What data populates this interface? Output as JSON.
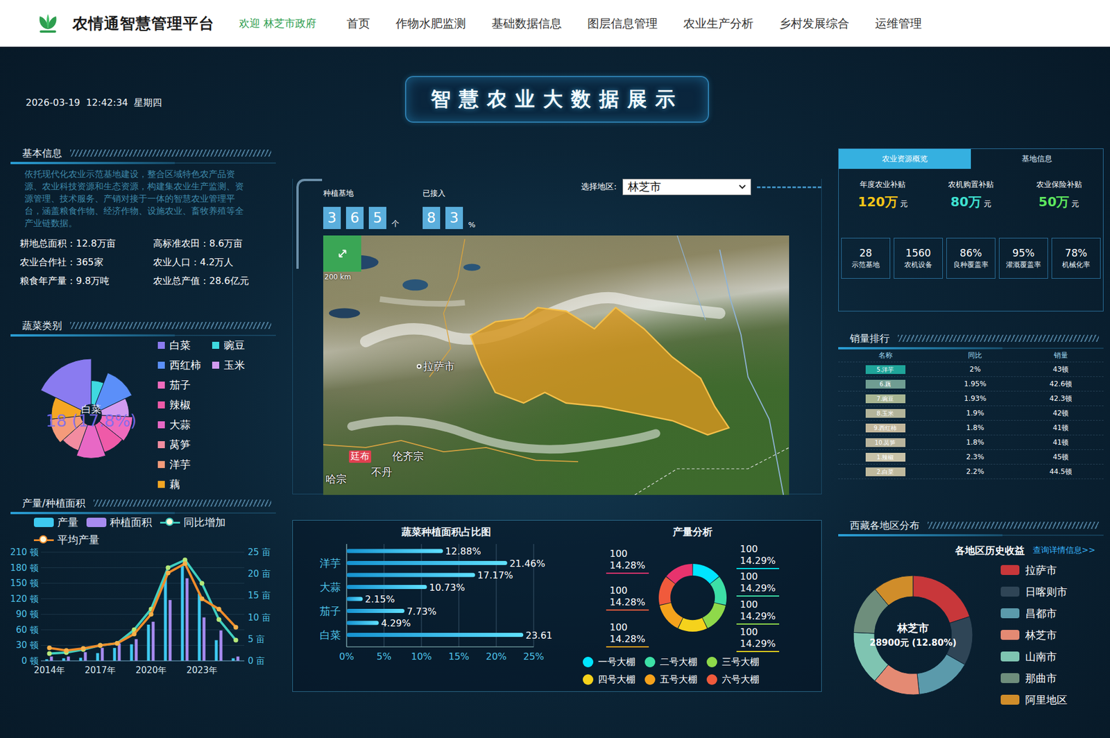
{
  "header": {
    "title": "农情通智慧管理平台",
    "welcome": "欢迎 林芝市政府",
    "nav": [
      {
        "label": "首页",
        "selected": false
      },
      {
        "label": "作物水肥监测",
        "selected": false
      },
      {
        "label": "基础数据信息",
        "selected": false
      },
      {
        "label": "图层信息管理",
        "selected": false
      },
      {
        "label": "农业生产分析",
        "selected": false
      },
      {
        "label": "乡村发展综合",
        "selected": false
      },
      {
        "label": "运维管理",
        "selected": false
      }
    ]
  },
  "datetime": "2026-03-19  12:42:34  星期四",
  "banner_title": "智慧农业大数据展示",
  "basic_info": {
    "title": "基本信息",
    "intro": "依托现代化农业示范基地建设，整合区域特色农产品资源、农业科技资源和生态资源，构建集农业生产监测、资源管理、技术服务、产销对接于一体的智慧农业管理平台，涵盖粮食作物、经济作物、设施农业、畜牧养殖等全产业链数据。",
    "stats": [
      {
        "label": "耕地总面积：",
        "value": "12.8万亩"
      },
      {
        "label": "高标准农田：",
        "value": "8.6万亩"
      },
      {
        "label": "农业合作社：",
        "value": "365家"
      },
      {
        "label": "农业人口：",
        "value": "4.2万人"
      },
      {
        "label": "粮食年产量：",
        "value": "9.8万吨"
      },
      {
        "label": "农业总产值：",
        "value": "28.6亿元"
      }
    ]
  },
  "veg_categories": {
    "title": "蔬菜类别",
    "center_name": "白菜",
    "center_value": "18 (17.8%)",
    "items": [
      {
        "name": "白菜",
        "value": 18,
        "color": "#8a7bf0"
      },
      {
        "name": "豌豆",
        "value": 6,
        "color": "#3fd9e0"
      },
      {
        "name": "西红柿",
        "value": 12,
        "color": "#5b8ff9"
      },
      {
        "name": "玉米",
        "value": 8,
        "color": "#d29bf0"
      },
      {
        "name": "茄子",
        "value": 10,
        "color": "#f06bbd"
      },
      {
        "name": "辣椒",
        "value": 9,
        "color": "#ef5aa8"
      },
      {
        "name": "大蒜",
        "value": 11,
        "color": "#e868c5"
      },
      {
        "name": "莴笋",
        "value": 8,
        "color": "#f28ca0"
      },
      {
        "name": "洋芋",
        "value": 10,
        "color": "#f59b7a"
      },
      {
        "name": "藕",
        "value": 9,
        "color": "#f5a623"
      }
    ]
  },
  "production": {
    "title": "产量/种植面积",
    "legend": [
      {
        "name": "产量",
        "kind": "bar",
        "color": "#3ec9f0"
      },
      {
        "name": "种植面积",
        "kind": "bar",
        "color": "#a78bf0"
      },
      {
        "name": "同比增加",
        "kind": "line",
        "color": "#3fcfc0"
      },
      {
        "name": "平均产量",
        "kind": "line",
        "color": "#f08c2a"
      }
    ],
    "left_ticks": [
      "210 顿",
      "180 顿",
      "150 顿",
      "120 顿",
      "90 顿",
      "60 顿",
      "30 顿",
      "0 顿"
    ],
    "right_ticks": [
      "25 亩",
      "20 亩",
      "15 亩",
      "10 亩",
      "5 亩",
      "0 亩"
    ],
    "x_labels": [
      "2014年",
      "2017年",
      "2020年",
      "2023年"
    ],
    "output": [
      3,
      5,
      6,
      15,
      25,
      32,
      70,
      160,
      185,
      130,
      40,
      5
    ],
    "area": [
      1,
      1,
      2,
      3,
      4,
      5,
      9,
      14,
      19,
      10,
      7,
      1
    ],
    "yoy": [
      14,
      16,
      22,
      30,
      34,
      60,
      100,
      180,
      195,
      150,
      80,
      40
    ],
    "avg": [
      25,
      20,
      24,
      30,
      34,
      52,
      90,
      170,
      188,
      120,
      100,
      65
    ]
  },
  "counters": [
    {
      "label": "种植基地",
      "digits": [
        "3",
        "6",
        "5"
      ],
      "unit": "个"
    },
    {
      "label": "已接入",
      "digits": [
        "8",
        "3"
      ],
      "unit": "%"
    }
  ],
  "region_select": {
    "label": "选择地区:",
    "value": "林芝市"
  },
  "map": {
    "scale": "200 km",
    "places": [
      {
        "name": "拉萨市",
        "kind": "city"
      },
      {
        "name": "廷布",
        "kind": "capital"
      },
      {
        "name": "伦齐宗",
        "kind": "label"
      },
      {
        "name": "不丹",
        "kind": "label"
      },
      {
        "name": "哈宗",
        "kind": "label"
      }
    ]
  },
  "area_share": {
    "title": "蔬菜种植面积占比图",
    "ticks": [
      "0%",
      "5%",
      "10%",
      "15%",
      "20%",
      "25%"
    ],
    "bars": [
      {
        "value": 12.88,
        "text": "12.88%"
      },
      {
        "label": "洋芋",
        "value": 21.46,
        "text": "21.46%"
      },
      {
        "value": 17.17,
        "text": "17.17%"
      },
      {
        "label": "大蒜",
        "value": 10.73,
        "text": "10.73%"
      },
      {
        "value": 2.15,
        "text": "2.15%"
      },
      {
        "label": "茄子",
        "value": 7.73,
        "text": "7.73%"
      },
      {
        "value": 4.29,
        "text": "4.29%"
      },
      {
        "label": "白菜",
        "value": 23.61,
        "text": "23.61"
      }
    ]
  },
  "yield_analysis": {
    "title": "产量分析",
    "segments": [
      {
        "value": 100,
        "text": "100",
        "share": "14.29%",
        "color": "#00e5ff"
      },
      {
        "value": 100,
        "text": "100",
        "share": "14.29%",
        "color": "#3de0a6"
      },
      {
        "value": 100,
        "text": "100",
        "share": "14.29%",
        "color": "#8fd94a"
      },
      {
        "value": 100,
        "text": "100",
        "share": "14.29%",
        "color": "#f5d21c"
      },
      {
        "value": 100,
        "text": "100",
        "share": "14.28%",
        "color": "#f5a21c"
      },
      {
        "value": 100,
        "text": "100",
        "share": "14.28%",
        "color": "#f05a3c"
      },
      {
        "value": 100,
        "text": "100",
        "share": "14.28%",
        "color": "#e8336d"
      }
    ],
    "legend": [
      {
        "name": "一号大棚",
        "color": "#00e5ff"
      },
      {
        "name": "二号大棚",
        "color": "#3de0a6"
      },
      {
        "name": "三号大棚",
        "color": "#8fd94a"
      },
      {
        "name": "四号大棚",
        "color": "#f5d21c"
      },
      {
        "name": "五号大棚",
        "color": "#f5a21c"
      },
      {
        "name": "六号大棚",
        "color": "#f05a3c"
      }
    ]
  },
  "resources": {
    "tabs": [
      {
        "label": "农业资源概览",
        "selected": true
      },
      {
        "label": "基地信息",
        "selected": false
      }
    ],
    "subsidies": [
      {
        "label": "年度农业补贴",
        "value": "120万",
        "unit": "元",
        "color": "#f5c518"
      },
      {
        "label": "农机购置补贴",
        "value": "80万",
        "unit": "元",
        "color": "#3fe0d0"
      },
      {
        "label": "农业保险补贴",
        "value": "50万",
        "unit": "元",
        "color": "#5ee65e"
      }
    ],
    "metrics": [
      {
        "value": "28",
        "label": "示范基地"
      },
      {
        "value": "1560",
        "label": "农机设备"
      },
      {
        "value": "86%",
        "label": "良种覆盖率"
      },
      {
        "value": "95%",
        "label": "灌溉覆盖率"
      },
      {
        "value": "78%",
        "label": "机械化率"
      }
    ]
  },
  "sales": {
    "title": "销量排行",
    "columns": [
      "名称",
      "同比",
      "销量"
    ],
    "rows": [
      {
        "name": "5.洋芋",
        "yoy": "2%",
        "sales": "43顿",
        "color": "#1fa59a"
      },
      {
        "name": "6.藕",
        "yoy": "1.95%",
        "sales": "42.6顿",
        "color": "#6f9d92"
      },
      {
        "name": "7.豌豆",
        "yoy": "1.93%",
        "sales": "42.3顿",
        "color": "#a7b593"
      },
      {
        "name": "8.玉米",
        "yoy": "1.9%",
        "sales": "42顿",
        "color": "#b3b49a"
      },
      {
        "name": "9.西红柿",
        "yoy": "1.8%",
        "sales": "41顿",
        "color": "#c2b79c"
      },
      {
        "name": "10.莴笋",
        "yoy": "1.8%",
        "sales": "41顿",
        "color": "#b9b49d"
      },
      {
        "name": "1.辣椒",
        "yoy": "2.3%",
        "sales": "45顿",
        "color": "#c8c2a8"
      },
      {
        "name": "2.白菜",
        "yoy": "2.2%",
        "sales": "44.5顿",
        "color": "#bfb99d"
      }
    ]
  },
  "regions": {
    "title": "西藏各地区分布",
    "chart_title": "各地区历史收益",
    "link": "查询详情信息>>",
    "center_name": "林芝市",
    "center_value": "28900元 (12.80%)",
    "items": [
      {
        "name": "拉萨市",
        "value": 45000,
        "color": "#c8373a"
      },
      {
        "name": "日喀则市",
        "value": 30000,
        "color": "#2f4556"
      },
      {
        "name": "昌都市",
        "value": 34000,
        "color": "#5b9aab"
      },
      {
        "name": "林芝市",
        "value": 28900,
        "color": "#e48a73"
      },
      {
        "name": "山南市",
        "value": 33000,
        "color": "#7fc4b1"
      },
      {
        "name": "那曲市",
        "value": 30000,
        "color": "#6e8e7c"
      },
      {
        "name": "阿里地区",
        "value": 24800,
        "color": "#d08d2a"
      }
    ]
  }
}
